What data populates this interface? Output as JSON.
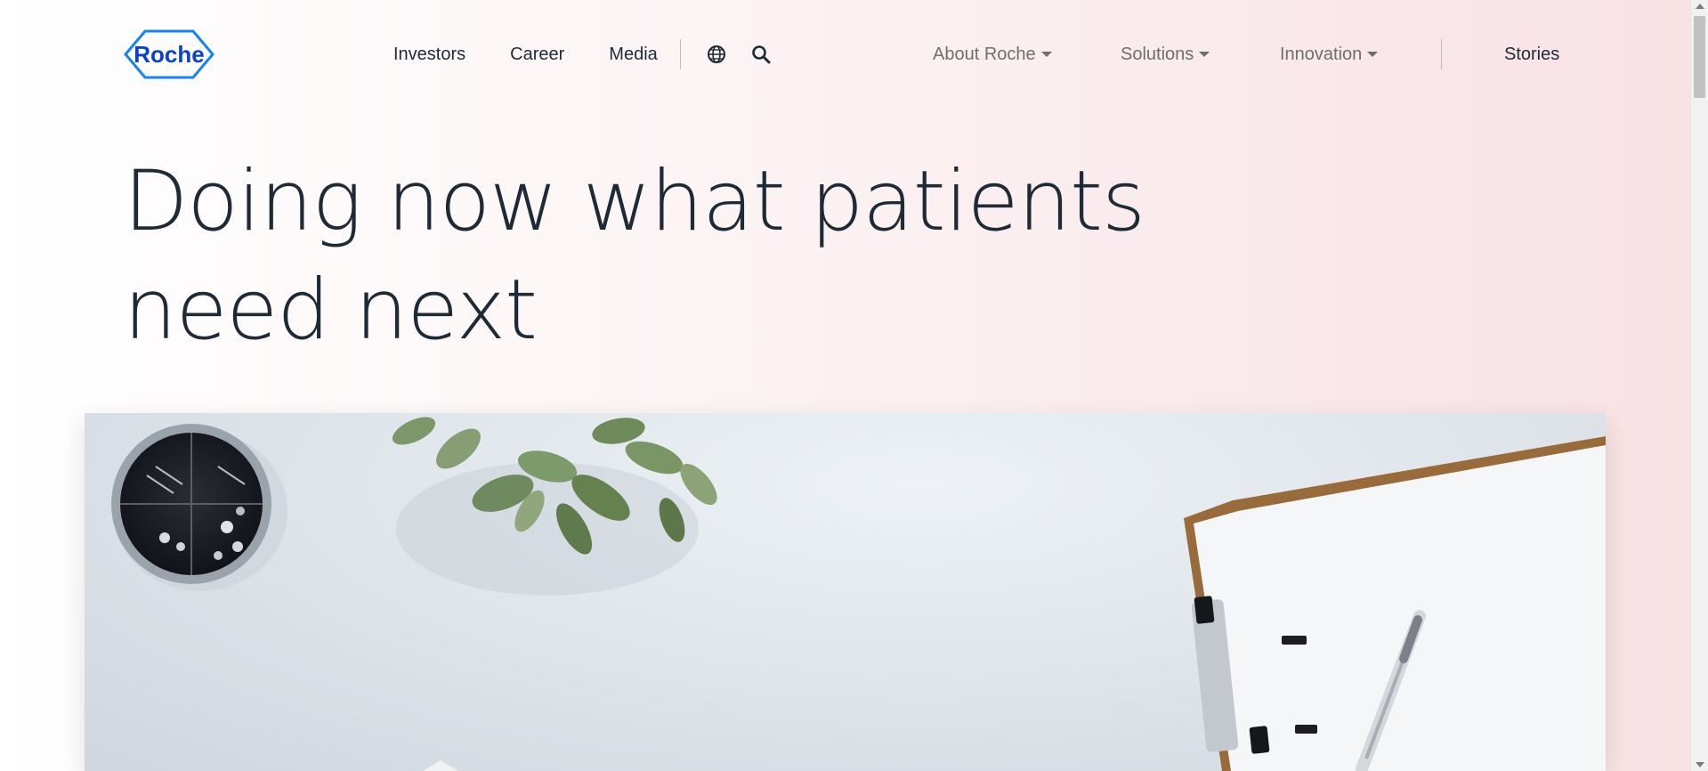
{
  "brand": {
    "logo_text": "Roche",
    "color": "#0b41cd",
    "logo_stroke": "#1482fa"
  },
  "nav_primary": [
    {
      "label": "Investors"
    },
    {
      "label": "Career"
    },
    {
      "label": "Media"
    }
  ],
  "nav_icons": {
    "language": "globe-icon",
    "search": "search-icon"
  },
  "nav_secondary": [
    {
      "label": "About Roche",
      "has_dropdown": true
    },
    {
      "label": "Solutions",
      "has_dropdown": true
    },
    {
      "label": "Innovation",
      "has_dropdown": true
    }
  ],
  "nav_stories": {
    "label": "Stories"
  },
  "hero": {
    "title": "Doing now what patients need next",
    "image_subject": "desk-with-plant-clipboard-pen-pins"
  },
  "colors": {
    "text": "#1f2a37",
    "muted": "#6e6e6e",
    "background_accent": "#f8e1e4"
  }
}
